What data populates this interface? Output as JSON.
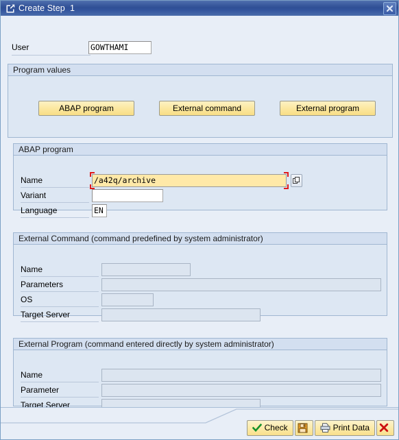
{
  "window": {
    "title": "Create Step  1",
    "title_icon": "create-step-icon",
    "close_icon": "close-icon"
  },
  "user": {
    "label": "User",
    "value": "GOWTHAMI",
    "placeholder": ""
  },
  "program_values": {
    "legend": "Program values",
    "buttons": [
      {
        "label": "ABAP program",
        "name": "abap-program"
      },
      {
        "label": "External command",
        "name": "external-command"
      },
      {
        "label": "External program",
        "name": "external-program"
      }
    ]
  },
  "abap_program": {
    "legend": "ABAP program",
    "name": {
      "label": "Name",
      "value": "/a42q/archive",
      "placeholder": ""
    },
    "variant": {
      "label": "Variant",
      "value": "",
      "placeholder": ""
    },
    "language": {
      "label": "Language",
      "value": "EN",
      "placeholder": ""
    },
    "search_help_icon": "search-help-icon"
  },
  "external_command": {
    "legend": "External Command (command predefined by system administrator)",
    "name": {
      "label": "Name",
      "value": "",
      "placeholder": ""
    },
    "parameters": {
      "label": "Parameters",
      "value": "",
      "placeholder": ""
    },
    "os": {
      "label": "OS",
      "value": "",
      "placeholder": ""
    },
    "target_server": {
      "label": "Target Server",
      "value": "",
      "placeholder": ""
    }
  },
  "external_program": {
    "legend": "External Program (command entered directly by system administrator)",
    "name": {
      "label": "Name",
      "value": "",
      "placeholder": ""
    },
    "parameter": {
      "label": "Parameter",
      "value": "",
      "placeholder": ""
    },
    "target_server": {
      "label": "Target Server",
      "value": "",
      "placeholder": ""
    }
  },
  "toolbar": {
    "check_label": "Check",
    "check_icon": "green-check-icon",
    "save_label": "",
    "save_icon": "save-disk-icon",
    "print_label": "Print Data",
    "print_icon": "printer-icon",
    "cancel_label": "",
    "cancel_icon": "red-x-icon"
  },
  "colors": {
    "titlebar": "#32539c",
    "accent_button": "#fbe79d",
    "focus_field": "#ffe9a8",
    "focus_marker": "#e01b1b",
    "canvas": "#e8eef7",
    "group": "#dde7f3"
  }
}
